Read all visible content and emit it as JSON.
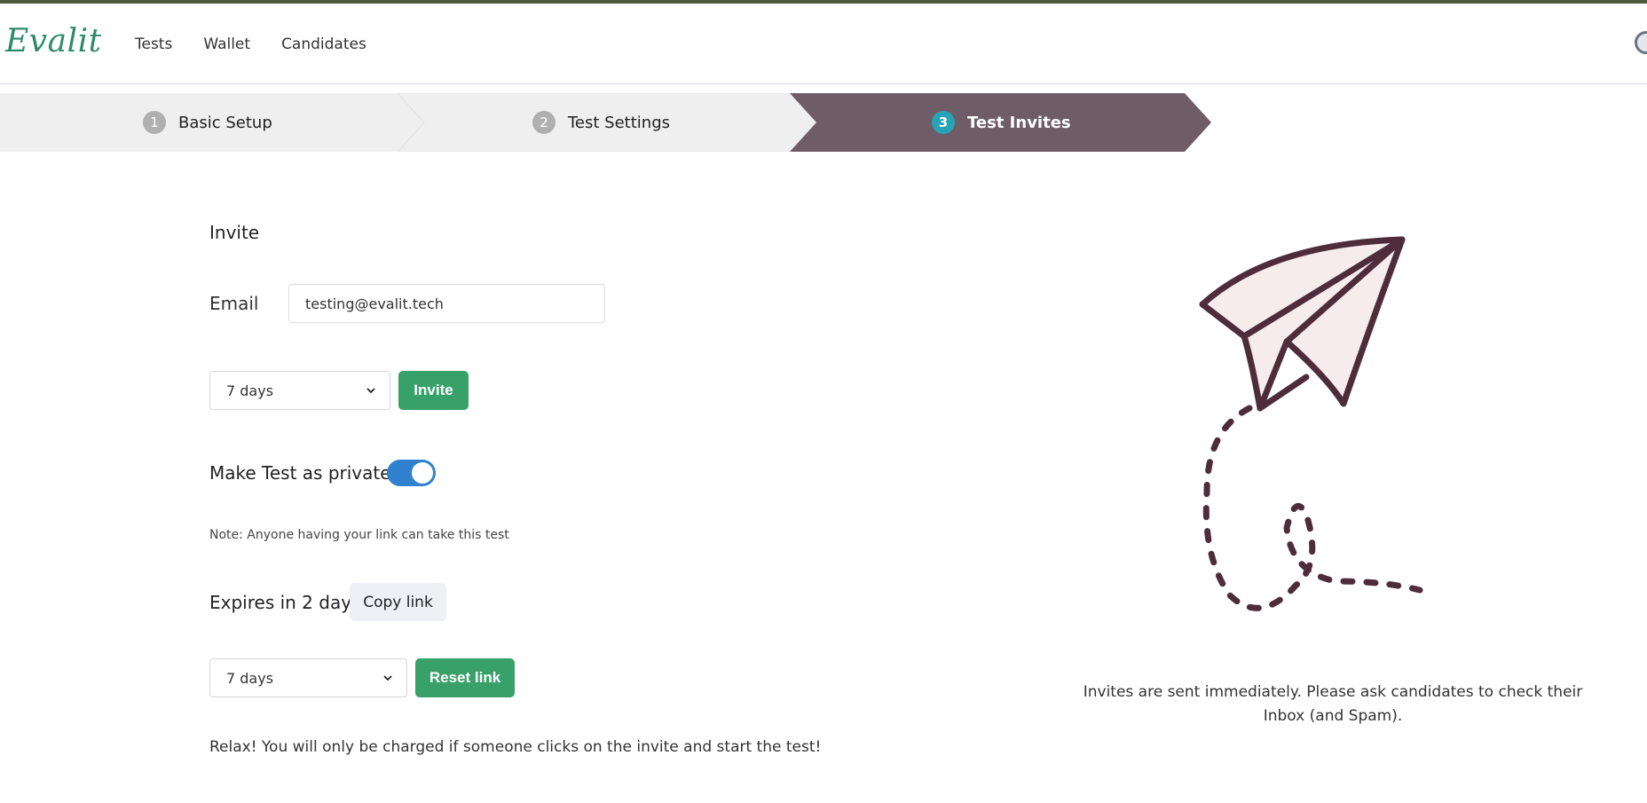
{
  "header": {
    "logo": "Evalit",
    "nav": [
      "Tests",
      "Wallet",
      "Candidates"
    ]
  },
  "stepper": {
    "steps": [
      {
        "num": "1",
        "label": "Basic Setup",
        "active": false
      },
      {
        "num": "2",
        "label": "Test Settings",
        "active": false
      },
      {
        "num": "3",
        "label": "Test Invites",
        "active": true
      }
    ],
    "colors": {
      "inactive": "#efefef",
      "active": "#6e5d66",
      "active_badge": "#27a3b5"
    }
  },
  "invite": {
    "title": "Invite",
    "email_label": "Email",
    "email_value": "testing@evalit.tech",
    "duration_value": "7 days",
    "invite_button": "Invite"
  },
  "privacy": {
    "label": "Make Test as private",
    "toggle_on": true,
    "note": "Note: Anyone having your link can take this test"
  },
  "link": {
    "expires_text": "Expires in 2 days",
    "copy_button": "Copy link",
    "duration_value": "7 days",
    "reset_button": "Reset link"
  },
  "footer_note": "Relax! You will only be charged if someone clicks on the invite and start the test!",
  "illustration": {
    "icon": "paper-plane-icon",
    "caption": "Invites are sent immediately. Please ask candidates to check their Inbox (and Spam)."
  },
  "colors": {
    "brand": "#2e8b6a",
    "primary_button": "#38a169",
    "toggle": "#3182ce",
    "plane_stroke": "#4e2c3a",
    "plane_fill": "#f6ecee"
  }
}
